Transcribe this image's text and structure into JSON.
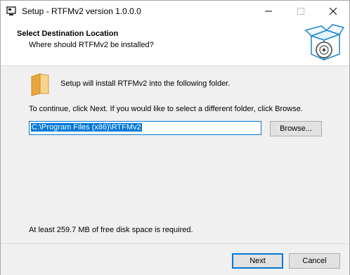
{
  "window": {
    "title": "Setup - RTFMv2 version 1.0.0.0",
    "icon": "setup-app-icon",
    "controls": [
      "minimize-icon",
      "maximize-icon",
      "close-icon"
    ]
  },
  "header": {
    "title": "Select Destination Location",
    "subtitle": "Where should RTFMv2 be installed?",
    "icon": "installer-box-disc-icon"
  },
  "main": {
    "install_text": "Setup will install RTFMv2 into the following folder.",
    "continue_text": "To continue, click Next. If you would like to select a different folder, click Browse.",
    "path_value": "C:\\Program Files (x86)\\RTFMv2",
    "browse_label": "Browse...",
    "disk_space_text": "At least 259.7 MB of free disk space is required.",
    "folder_icon": "folder-icon"
  },
  "footer": {
    "next_label": "Next",
    "cancel_label": "Cancel"
  },
  "colors": {
    "accent": "#0078d7",
    "panel": "#f0f0f0",
    "button": "#e1e1e1"
  }
}
